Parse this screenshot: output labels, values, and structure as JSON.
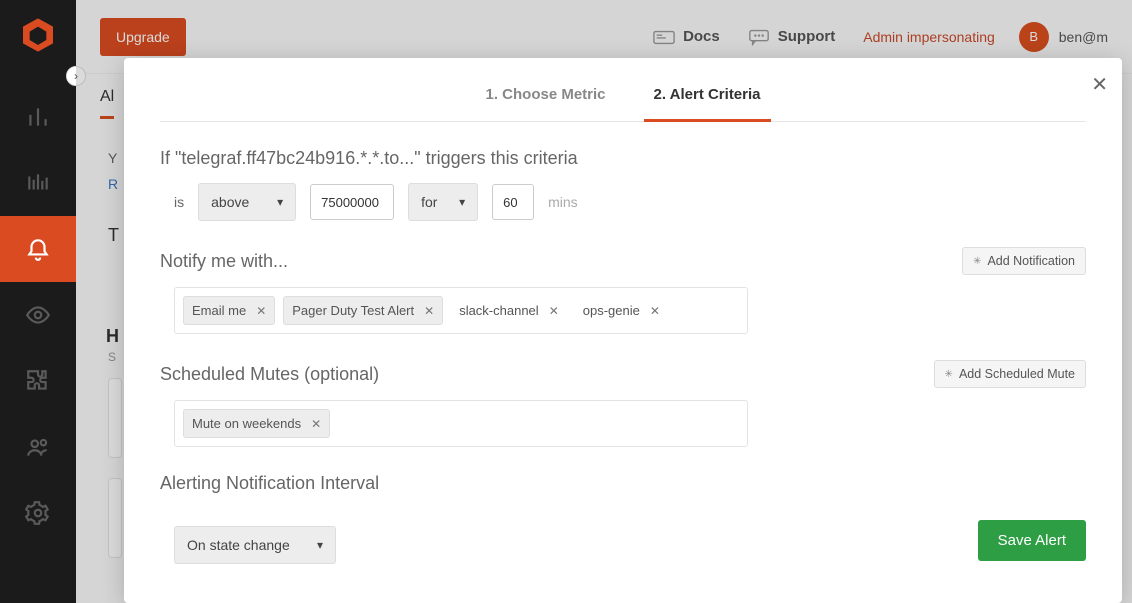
{
  "topbar": {
    "upgrade_label": "Upgrade",
    "docs_label": "Docs",
    "support_label": "Support",
    "impersonating_label": "Admin impersonating",
    "avatar_initial": "B",
    "username": "ben@m"
  },
  "background": {
    "tab": "Al",
    "y": "Y",
    "r": "R",
    "t": "T",
    "h": "H",
    "s": "S"
  },
  "modal": {
    "step1_label": "1. Choose Metric",
    "step2_label": "2. Alert Criteria",
    "criteria_heading": "If \"telegraf.ff47bc24b916.*.*.to...\" triggers this criteria",
    "is_label": "is",
    "comparator": "above",
    "threshold_value": "75000000",
    "for_label": "for",
    "duration_value": "60",
    "mins_label": "mins",
    "notify_heading": "Notify me with...",
    "add_notification_label": "Add Notification",
    "notifications": {
      "0": "Email me",
      "1": "Pager Duty Test Alert",
      "2": "slack-channel",
      "3": "ops-genie"
    },
    "mutes_heading": "Scheduled Mutes (optional)",
    "add_mute_label": "Add Scheduled Mute",
    "mutes": {
      "0": "Mute on weekends"
    },
    "interval_heading": "Alerting Notification Interval",
    "interval_value": "On state change",
    "save_label": "Save Alert"
  }
}
